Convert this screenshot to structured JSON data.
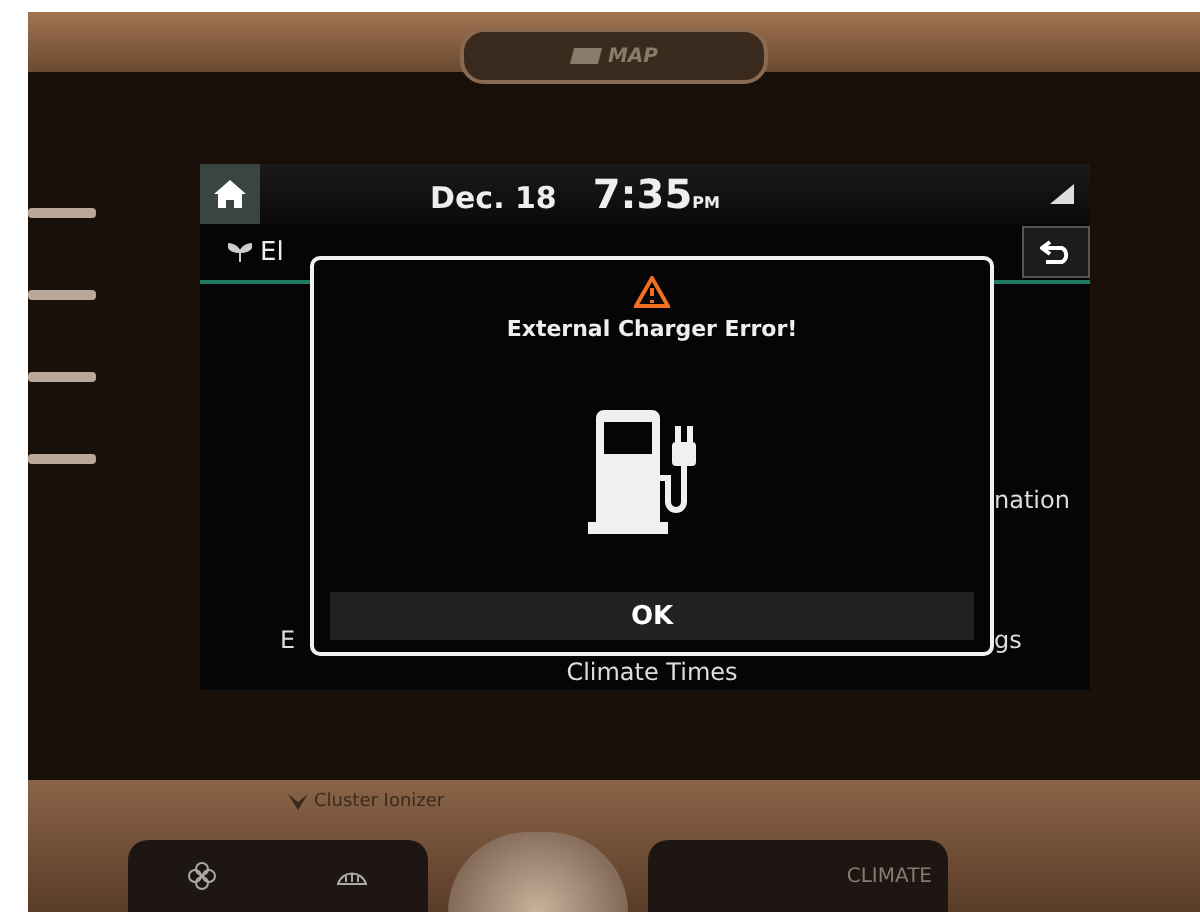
{
  "top_trim": {
    "slot_label": "MAP"
  },
  "screen": {
    "status_bar": {
      "date": "Dec. 18",
      "time": "7:35",
      "meridiem": "PM"
    },
    "header": {
      "title": "El"
    },
    "menu": {
      "left": [
        "E"
      ],
      "center": [
        "Climate Times"
      ],
      "right": [
        "nation",
        "gs"
      ]
    },
    "dialog": {
      "title": "External Charger Error!",
      "button": "OK"
    }
  },
  "control_panel": {
    "label": "Cluster Ionizer",
    "climate_button": "CLIMATE"
  }
}
